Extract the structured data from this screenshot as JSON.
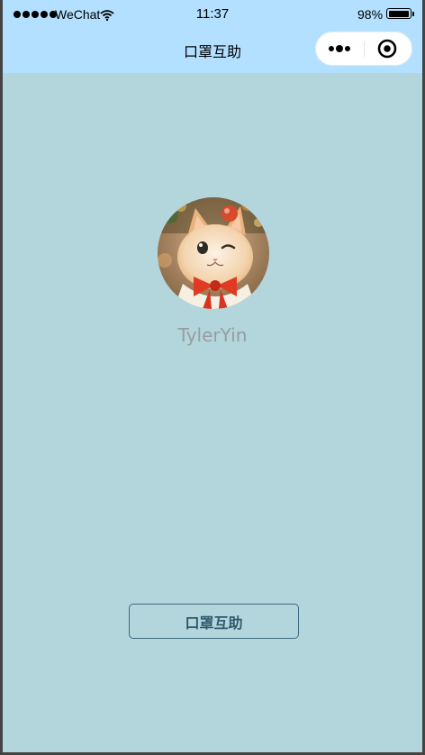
{
  "status_bar": {
    "carrier": "WeChat",
    "time": "11:37",
    "battery_percent": "98%",
    "battery_level": 0.98,
    "signal_icon": "signal-dots-icon",
    "wifi_icon": "wifi-icon",
    "battery_icon": "battery-icon"
  },
  "nav": {
    "title": "口罩互助",
    "more_icon": "more-dots-icon",
    "close_icon": "mini-program-close-icon"
  },
  "profile": {
    "avatar_icon": "cat-avatar-image",
    "username": "TylerYin"
  },
  "main": {
    "button_label": "口罩互助"
  },
  "colors": {
    "page_background": "#b3d5dc",
    "navbar_background": "#b3e0fe",
    "username_text": "#979da0",
    "button_border": "#3d6b80",
    "button_text": "#2f5a6e"
  }
}
